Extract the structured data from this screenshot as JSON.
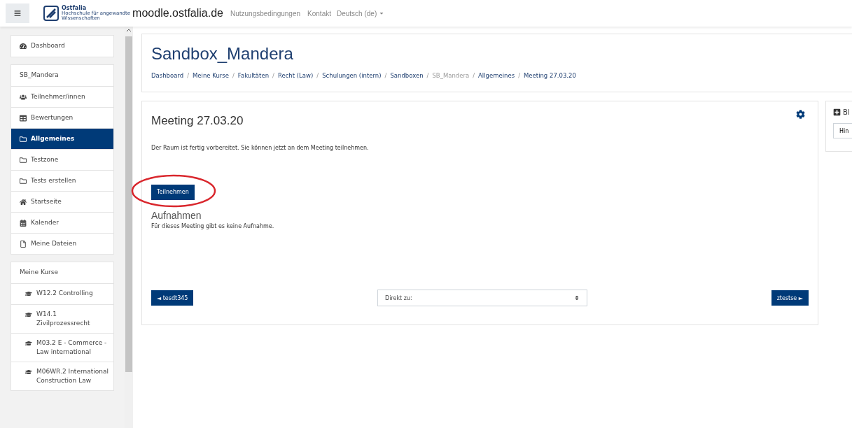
{
  "navbar": {
    "logo": {
      "name": "Ostfalia",
      "line_1": "Hochschule für angewandte",
      "line_2": "Wissenschaften"
    },
    "site": "moodle.ostfalia.de",
    "links": [
      "Nutzungsbedingungen",
      "Kontakt"
    ],
    "language": "Deutsch (de)"
  },
  "sidebar": {
    "groups": [
      {
        "items": [
          {
            "kind": "link",
            "label": "Dashboard",
            "selected": false
          }
        ]
      },
      {
        "items": [
          {
            "kind": "heading",
            "label": "SB_Mandera",
            "selected": false
          },
          {
            "kind": "link",
            "label": "Teilnehmer/innen",
            "selected": false
          },
          {
            "kind": "link",
            "label": "Bewertungen",
            "selected": false
          },
          {
            "kind": "link",
            "label": "Allgemeines",
            "selected": true
          },
          {
            "kind": "link",
            "label": "Testzone",
            "selected": false
          },
          {
            "kind": "link",
            "label": "Tests erstellen",
            "selected": false
          },
          {
            "kind": "link",
            "label": "Startseite",
            "selected": false
          },
          {
            "kind": "link",
            "label": "Kalender",
            "selected": false
          },
          {
            "kind": "link",
            "label": "Meine Dateien",
            "selected": false
          }
        ]
      },
      {
        "items": [
          {
            "kind": "heading",
            "label": "Meine Kurse",
            "selected": false
          },
          {
            "kind": "course",
            "label": "W12.2 Controlling",
            "selected": false
          },
          {
            "kind": "course",
            "label": "W14.1 Zivilprozessrecht",
            "selected": false
          },
          {
            "kind": "course",
            "label": "M03.2 E - Commerce - Law international",
            "selected": false
          },
          {
            "kind": "course",
            "label": "M06WR.2 International Construction Law",
            "selected": false
          }
        ]
      }
    ]
  },
  "header": {
    "title": "Sandbox_Mandera",
    "separator": "/",
    "breadcrumb": [
      {
        "label": "Dashboard",
        "disabled": false
      },
      {
        "label": "Meine Kurse",
        "disabled": false
      },
      {
        "label": "Fakultäten",
        "disabled": false
      },
      {
        "label": "Recht (Law)",
        "disabled": false
      },
      {
        "label": "Schulungen (intern)",
        "disabled": false
      },
      {
        "label": "Sandboxen",
        "disabled": false
      },
      {
        "label": "SB_Mandera",
        "disabled": true
      },
      {
        "label": "Allgemeines",
        "disabled": false
      },
      {
        "label": "Meeting 27.03.20",
        "disabled": false
      }
    ]
  },
  "content": {
    "title": "Meeting 27.03.20",
    "message": "Der Raum ist fertig vorbereitet. Sie können jetzt an dem Meeting teilnehmen.",
    "join_button": "Teilnehmen",
    "recordings_title": "Aufnahmen",
    "recordings_message": "Für dieses Meeting gibt es keine Aufnahme.",
    "prev_button": "◄ tesdt345",
    "jump_select": "Direkt zu:",
    "next_button": "ztestse ►"
  },
  "blocks": {
    "title": "Bl",
    "add_button": "Hin"
  }
}
